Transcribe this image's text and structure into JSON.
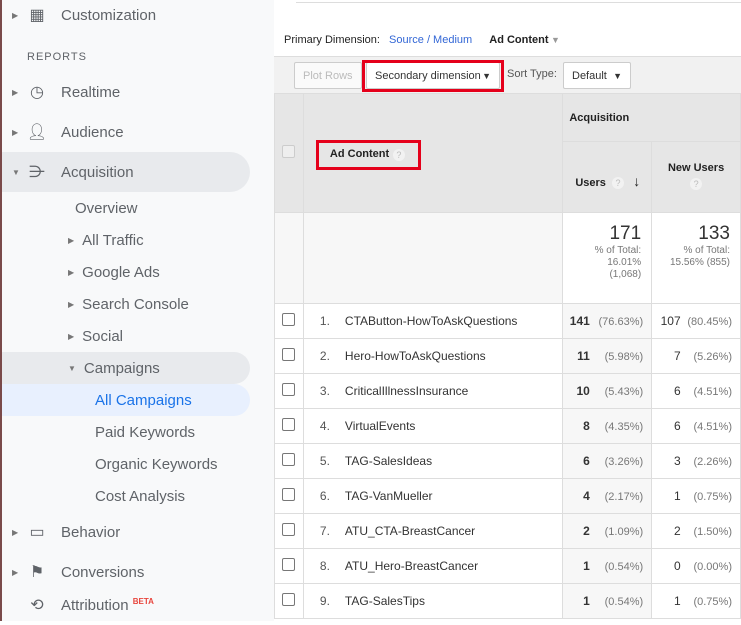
{
  "sidebar": {
    "customization": "Customization",
    "reports_heading": "REPORTS",
    "realtime": "Realtime",
    "audience": "Audience",
    "acquisition": "Acquisition",
    "overview": "Overview",
    "all_traffic": "All Traffic",
    "google_ads": "Google Ads",
    "search_console": "Search Console",
    "social": "Social",
    "campaigns": "Campaigns",
    "all_campaigns": "All Campaigns",
    "paid_keywords": "Paid Keywords",
    "organic_keywords": "Organic Keywords",
    "cost_analysis": "Cost Analysis",
    "behavior": "Behavior",
    "conversions": "Conversions",
    "attribution": "Attribution",
    "beta_badge": "BETA"
  },
  "primary_dimension": {
    "label": "Primary Dimension:",
    "link": "Source / Medium",
    "active": "Ad Content"
  },
  "toolbar": {
    "plot_rows": "Plot Rows",
    "secondary_dimension": "Secondary dimension",
    "sort_type_label": "Sort Type:",
    "sort_type_value": "Default"
  },
  "table": {
    "dimension_header": "Ad Content",
    "group_header": "Acquisition",
    "users_header": "Users",
    "new_users_header": "New Users",
    "totals": {
      "users": "171",
      "users_pct_label": "% of Total:",
      "users_pct": "16.01%",
      "users_total": "(1,068)",
      "new_users": "133",
      "new_users_pct_label": "% of Total:",
      "new_users_pct": "15.56% (855)"
    },
    "rows": [
      {
        "n": "1.",
        "name": "CTAButton-HowToAskQuestions",
        "users": "141",
        "users_pct": "(76.63%)",
        "new": "107",
        "new_pct": "(80.45%)"
      },
      {
        "n": "2.",
        "name": "Hero-HowToAskQuestions",
        "users": "11",
        "users_pct": "(5.98%)",
        "new": "7",
        "new_pct": "(5.26%)"
      },
      {
        "n": "3.",
        "name": "CriticalIllnessInsurance",
        "users": "10",
        "users_pct": "(5.43%)",
        "new": "6",
        "new_pct": "(4.51%)"
      },
      {
        "n": "4.",
        "name": "VirtualEvents",
        "users": "8",
        "users_pct": "(4.35%)",
        "new": "6",
        "new_pct": "(4.51%)"
      },
      {
        "n": "5.",
        "name": "TAG-SalesIdeas",
        "users": "6",
        "users_pct": "(3.26%)",
        "new": "3",
        "new_pct": "(2.26%)"
      },
      {
        "n": "6.",
        "name": "TAG-VanMueller",
        "users": "4",
        "users_pct": "(2.17%)",
        "new": "1",
        "new_pct": "(0.75%)"
      },
      {
        "n": "7.",
        "name": "ATU_CTA-BreastCancer",
        "users": "2",
        "users_pct": "(1.09%)",
        "new": "2",
        "new_pct": "(1.50%)"
      },
      {
        "n": "8.",
        "name": "ATU_Hero-BreastCancer",
        "users": "1",
        "users_pct": "(0.54%)",
        "new": "0",
        "new_pct": "(0.00%)"
      },
      {
        "n": "9.",
        "name": "TAG-SalesTips",
        "users": "1",
        "users_pct": "(0.54%)",
        "new": "1",
        "new_pct": "(0.75%)"
      }
    ]
  },
  "colors": {
    "highlight_box": "#e5001b",
    "link": "#3367d6",
    "selected_nav": "#e8f0fe"
  }
}
